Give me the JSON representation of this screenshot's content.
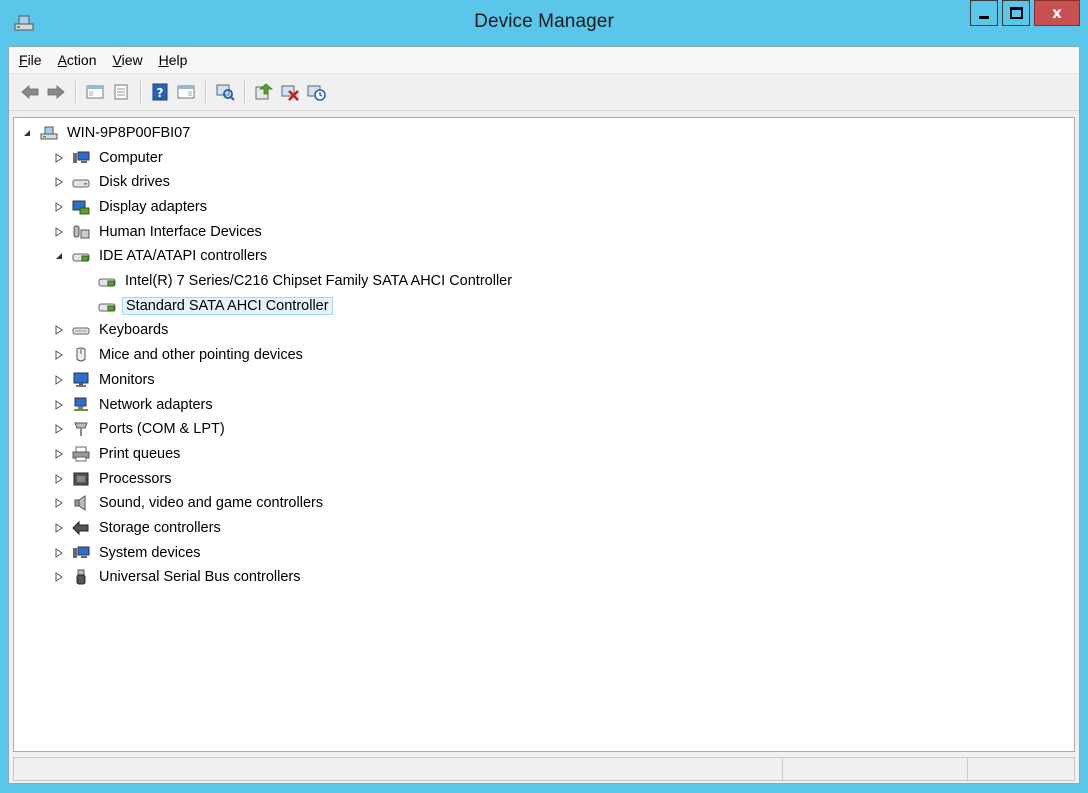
{
  "window": {
    "title": "Device Manager",
    "close_glyph": "x"
  },
  "menu": [
    {
      "label_acc": "F",
      "label_rest": "ile"
    },
    {
      "label_acc": "A",
      "label_rest": "ction"
    },
    {
      "label_acc": "V",
      "label_rest": "iew"
    },
    {
      "label_acc": "H",
      "label_rest": "elp"
    }
  ],
  "toolbar": [
    "back-icon",
    "forward-icon",
    "show-hide-console-tree-icon",
    "properties-icon",
    "help-icon",
    "show-hide-action-pane-icon",
    "scan-hardware-changes-icon",
    "update-driver-icon",
    "disable-device-icon",
    "uninstall-device-icon"
  ],
  "tree": {
    "root": "WIN-9P8P00FBI07",
    "categories": [
      {
        "label": "Computer",
        "icon": "computer-icon"
      },
      {
        "label": "Disk drives",
        "icon": "disk-drive-icon"
      },
      {
        "label": "Display adapters",
        "icon": "display-adapter-icon"
      },
      {
        "label": "Human Interface Devices",
        "icon": "hid-icon"
      },
      {
        "label": "IDE ATA/ATAPI controllers",
        "icon": "ide-controller-icon",
        "expanded": true
      },
      {
        "label": "Keyboards",
        "icon": "keyboard-icon"
      },
      {
        "label": "Mice and other pointing devices",
        "icon": "mouse-icon"
      },
      {
        "label": "Monitors",
        "icon": "monitor-icon"
      },
      {
        "label": "Network adapters",
        "icon": "network-adapter-icon"
      },
      {
        "label": "Ports (COM & LPT)",
        "icon": "port-icon"
      },
      {
        "label": "Print queues",
        "icon": "printer-icon"
      },
      {
        "label": "Processors",
        "icon": "processor-icon"
      },
      {
        "label": "Sound, video and game controllers",
        "icon": "speaker-icon"
      },
      {
        "label": "Storage controllers",
        "icon": "storage-controller-icon"
      },
      {
        "label": "System devices",
        "icon": "system-devices-icon"
      },
      {
        "label": "Universal Serial Bus controllers",
        "icon": "usb-icon"
      }
    ],
    "ide_children": [
      {
        "label": "Intel(R) 7 Series/C216 Chipset Family SATA AHCI Controller"
      },
      {
        "label": "Standard SATA AHCI Controller",
        "selected": true
      }
    ]
  },
  "colors": {
    "title_bar": "#5ac6ea",
    "close_button": "#c75050",
    "selection": "#e5f3fb"
  }
}
